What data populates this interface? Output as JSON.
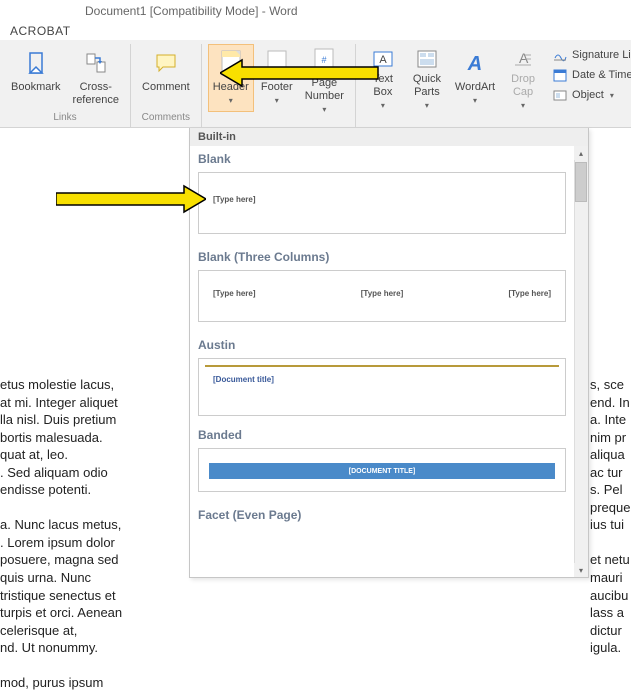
{
  "title": "Document1 [Compatibility Mode] - Word",
  "menu": {
    "acrobat": "ACROBAT"
  },
  "ribbon": {
    "bookmark": "Bookmark",
    "crossref": "Cross-\nreference",
    "comment": "Comment",
    "header": "Header",
    "footer": "Footer",
    "pagenum": "Page\nNumber",
    "textbox": "Text\nBox",
    "quickparts": "Quick\nParts",
    "wordart": "WordArt",
    "dropcap": "Drop\nCap",
    "signature": "Signature Line",
    "datetime": "Date & Time",
    "object": "Object",
    "group_links": "Links",
    "group_comments": "Comments"
  },
  "gallery": {
    "builtin": "Built-in",
    "blank": "Blank",
    "blank3": "Blank (Three Columns)",
    "austin": "Austin",
    "banded": "Banded",
    "facet": "Facet (Even Page)",
    "ph_type": "[Type here]",
    "ph_doctitle": "[Document title]",
    "ph_doctitle_caps": "[DOCUMENT TITLE]"
  },
  "doc_left": "etus molestie lacus,\nat mi. Integer aliquet\nlla nisl. Duis pretium\nbortis malesuada.\nquat at, leo.\n. Sed aliquam odio\nendisse potenti.\n\na. Nunc lacus metus,\n. Lorem ipsum dolor\nposuere, magna sed\nquis urna. Nunc\ntristique senectus et\nturpis et orci. Aenean\ncelerisque at,\nnd. Ut nonummy.\n\nmod, purus ipsum",
  "doc_right": "s, sce\nend. In\na. Inte\nnim pr\naliqua\nac tur\ns. Pel\npreque\nius tui\n\net netu\nmauri\naucibu\nlass a\ndictur\nigula."
}
